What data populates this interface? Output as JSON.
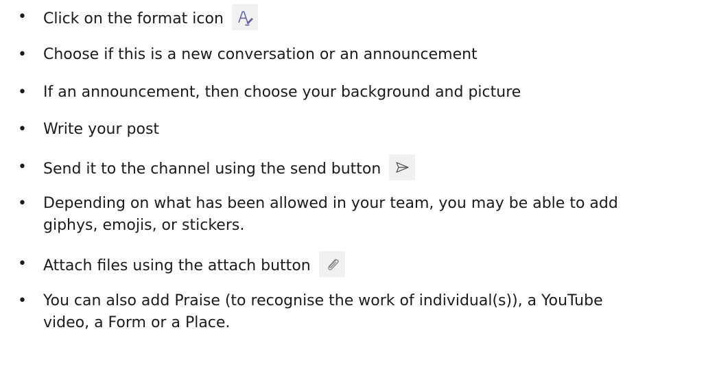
{
  "bullets": [
    {
      "text": "Click on the format  icon",
      "icon": "format-icon"
    },
    {
      "text": "Choose if this is a new conversation or an announcement"
    },
    {
      "text": "If an announcement, then choose your background and picture"
    },
    {
      "text": "Write your post"
    },
    {
      "text": "Send it to the channel using the send button",
      "icon": "send-icon"
    },
    {
      "line1": "Depending on what has been allowed in your team, you may be able to add",
      "line2": "giphys, emojis, or stickers."
    },
    {
      "text": "Attach files using the attach button",
      "icon": "attach-icon"
    },
    {
      "line1": "You can also add Praise (to recognise the work of individual(s)), a YouTube",
      "line2": "video, a Form or a Place."
    }
  ],
  "bullet_char": "•",
  "colors": {
    "text": "#1a1a1a",
    "icon_bg": "#f1f1f1",
    "format_icon": "#6264a7",
    "send_icon": "#5a5a5a",
    "attach_icon": "#8a8a8a"
  }
}
